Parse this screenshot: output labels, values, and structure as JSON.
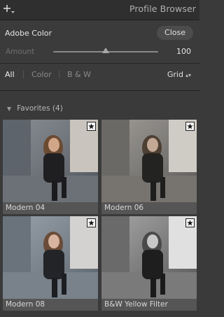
{
  "header": {
    "title": "Profile Browser",
    "icon": "add-plus-icon"
  },
  "profile": {
    "name": "Adobe Color",
    "close_label": "Close",
    "amount_label": "Amount",
    "amount_value": "100",
    "amount_fraction": 0.5
  },
  "tabs": [
    {
      "label": "All",
      "active": true
    },
    {
      "label": "Color",
      "active": false
    },
    {
      "label": "B & W",
      "active": false
    }
  ],
  "view": {
    "label": "Grid"
  },
  "favorites": {
    "label": "Favorites (4)"
  },
  "tiles": [
    {
      "name": "Modern 04",
      "favorite": true,
      "tone": "color"
    },
    {
      "name": "Modern 06",
      "favorite": true,
      "tone": "muted"
    },
    {
      "name": "Modern 08",
      "favorite": true,
      "tone": "cool"
    },
    {
      "name": "B&W Yellow Filter",
      "favorite": true,
      "tone": "bw"
    }
  ]
}
